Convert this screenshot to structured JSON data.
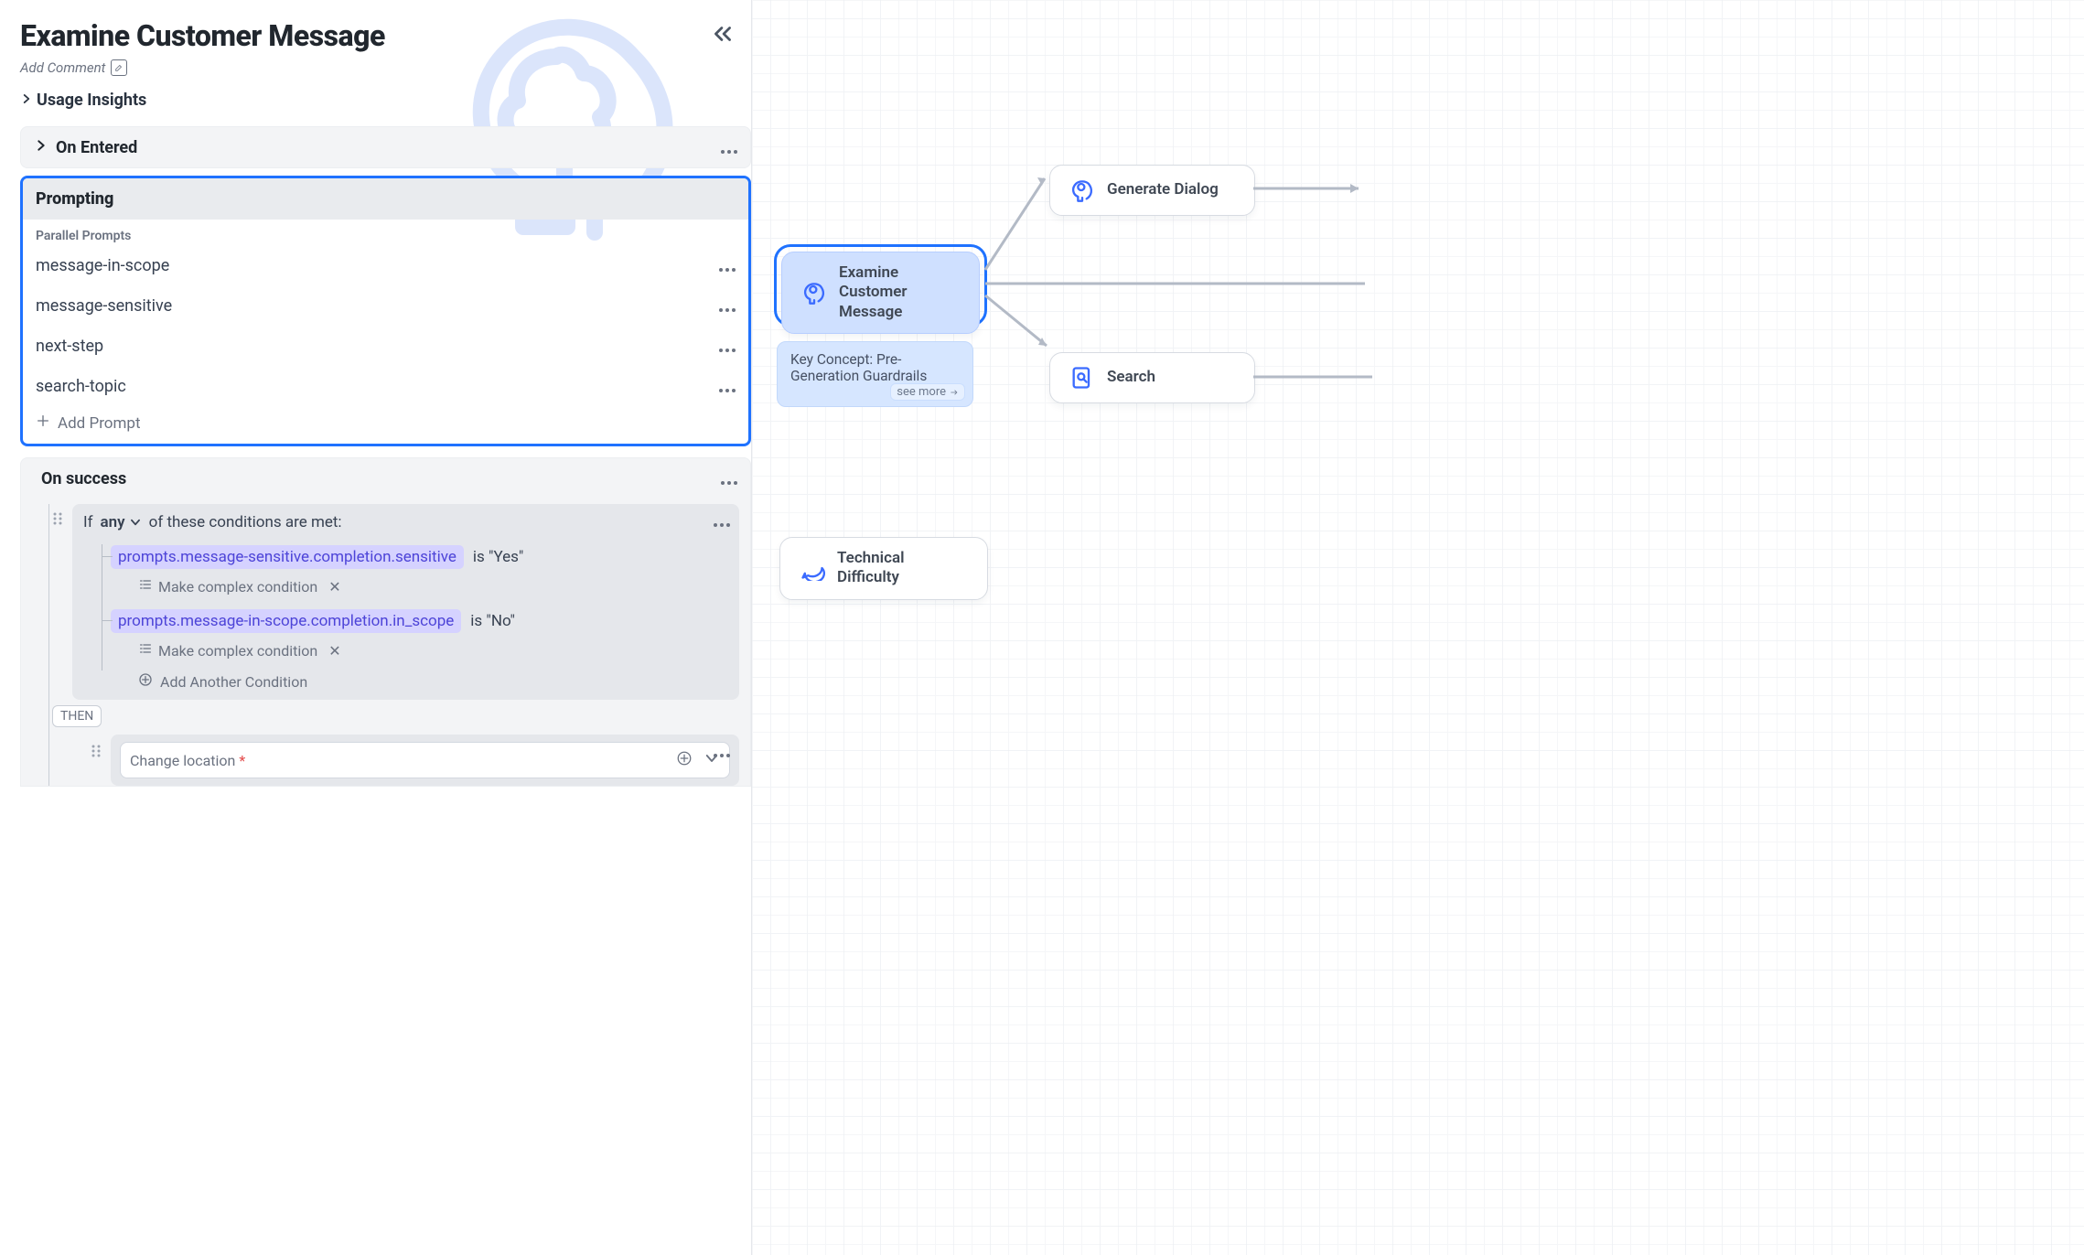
{
  "header": {
    "title": "Examine Customer Message",
    "add_comment": "Add Comment",
    "usage_insights": "Usage Insights"
  },
  "sections": {
    "on_entered": "On Entered",
    "prompting": {
      "title": "Prompting",
      "sublabel": "Parallel Prompts",
      "prompts": [
        "message-in-scope",
        "message-sensitive",
        "next-step",
        "search-topic"
      ],
      "add_prompt": "Add Prompt"
    },
    "on_success": {
      "title": "On success",
      "if_label": "If",
      "any_label": "any",
      "of_these": "of these conditions are met:",
      "conditions": [
        {
          "expr": "prompts.message-sensitive.completion.sensitive",
          "eq": "is \"Yes\""
        },
        {
          "expr": "prompts.message-in-scope.completion.in_scope",
          "eq": "is \"No\""
        }
      ],
      "make_complex": "Make complex condition",
      "add_another": "Add Another Condition",
      "then": "THEN",
      "action": {
        "label": "Change location",
        "required": "*"
      }
    }
  },
  "canvas": {
    "examine": "Examine Customer Message",
    "generate": "Generate Dialog",
    "search": "Search",
    "technical": "Technical Difficulty",
    "note": "Key Concept: Pre-Generation Guardrails",
    "see_more": "see more"
  }
}
